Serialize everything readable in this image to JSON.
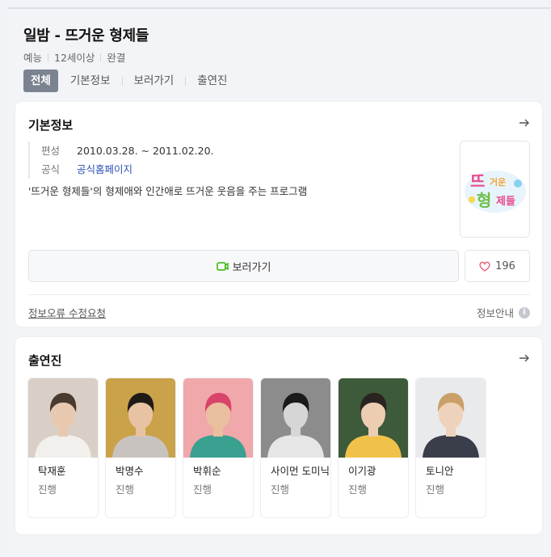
{
  "header": {
    "title": "일밤 - 뜨거운 형제들",
    "meta": [
      "예능",
      "12세이상",
      "완결"
    ],
    "tabs": [
      {
        "label": "전체",
        "active": true
      },
      {
        "label": "기본정보"
      },
      {
        "label": "보러가기"
      },
      {
        "label": "출연진"
      }
    ]
  },
  "basic_info": {
    "title": "기본정보",
    "rows": [
      {
        "key": "편성",
        "value": "2010.03.28. ~ 2011.02.20."
      },
      {
        "key": "공식",
        "value": "공식홈페이지"
      }
    ],
    "description": "'뜨거운 형제들'의 형제애와 인간애로 뜨거운 웃음을 주는 프로그램",
    "poster_icon": "show-logo-image",
    "watch_label": "보러가기",
    "like_count": "196",
    "report_label": "정보오류 수정요청",
    "guide_label": "정보안내",
    "accent": "#2db400"
  },
  "cast": {
    "title": "출연진",
    "members": [
      {
        "name": "탁재훈",
        "role": "진행",
        "bg": "#d9cfc6",
        "skin": "#e8c9b0",
        "hair": "#4a3b30",
        "shirt": "#f2f0ec"
      },
      {
        "name": "박명수",
        "role": "진행",
        "bg": "#c9a24a",
        "skin": "#e7c3a4",
        "hair": "#1d1a18",
        "shirt": "#c9c3c0"
      },
      {
        "name": "박휘순",
        "role": "진행",
        "bg": "#f0a8ab",
        "skin": "#e9bf9e",
        "hair": "#d8446a",
        "shirt": "#3aa090"
      },
      {
        "name": "사이먼 도미닉",
        "role": "진행",
        "bg": "#8c8c8c",
        "skin": "#d6d6d6",
        "hair": "#1a1a1a",
        "shirt": "#e6e6e6"
      },
      {
        "name": "이기광",
        "role": "진행",
        "bg": "#3d5a3a",
        "skin": "#edcdb2",
        "hair": "#2a2320",
        "shirt": "#f0c24a"
      },
      {
        "name": "토니안",
        "role": "진행",
        "bg": "#e8eaec",
        "skin": "#efd2bb",
        "hair": "#c9a068",
        "shirt": "#3a3e4a"
      }
    ]
  }
}
